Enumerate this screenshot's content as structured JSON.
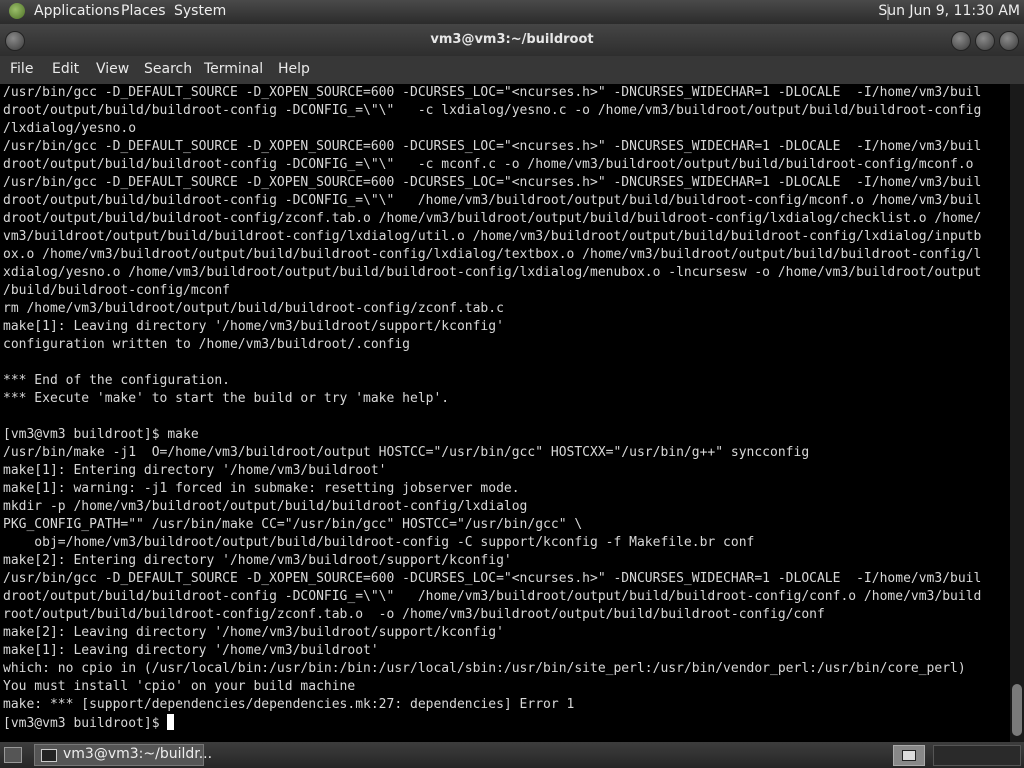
{
  "top_panel": {
    "menus": [
      "Applications",
      "Places",
      "System"
    ],
    "clock": "Sun Jun  9, 11:30 AM"
  },
  "window": {
    "title": "vm3@vm3:~/buildroot"
  },
  "menubar": [
    "File",
    "Edit",
    "View",
    "Search",
    "Terminal",
    "Help"
  ],
  "terminal": {
    "lines": [
      "/usr/bin/gcc -D_DEFAULT_SOURCE -D_XOPEN_SOURCE=600 -DCURSES_LOC=\"<ncurses.h>\" -DNCURSES_WIDECHAR=1 -DLOCALE  -I/home/vm3/buil",
      "droot/output/build/buildroot-config -DCONFIG_=\\\"\\\"   -c lxdialog/yesno.c -o /home/vm3/buildroot/output/build/buildroot-config",
      "/lxdialog/yesno.o",
      "/usr/bin/gcc -D_DEFAULT_SOURCE -D_XOPEN_SOURCE=600 -DCURSES_LOC=\"<ncurses.h>\" -DNCURSES_WIDECHAR=1 -DLOCALE  -I/home/vm3/buil",
      "droot/output/build/buildroot-config -DCONFIG_=\\\"\\\"   -c mconf.c -o /home/vm3/buildroot/output/build/buildroot-config/mconf.o",
      "/usr/bin/gcc -D_DEFAULT_SOURCE -D_XOPEN_SOURCE=600 -DCURSES_LOC=\"<ncurses.h>\" -DNCURSES_WIDECHAR=1 -DLOCALE  -I/home/vm3/buil",
      "droot/output/build/buildroot-config -DCONFIG_=\\\"\\\"   /home/vm3/buildroot/output/build/buildroot-config/mconf.o /home/vm3/buil",
      "droot/output/build/buildroot-config/zconf.tab.o /home/vm3/buildroot/output/build/buildroot-config/lxdialog/checklist.o /home/",
      "vm3/buildroot/output/build/buildroot-config/lxdialog/util.o /home/vm3/buildroot/output/build/buildroot-config/lxdialog/inputb",
      "ox.o /home/vm3/buildroot/output/build/buildroot-config/lxdialog/textbox.o /home/vm3/buildroot/output/build/buildroot-config/l",
      "xdialog/yesno.o /home/vm3/buildroot/output/build/buildroot-config/lxdialog/menubox.o -lncursesw -o /home/vm3/buildroot/output",
      "/build/buildroot-config/mconf",
      "rm /home/vm3/buildroot/output/build/buildroot-config/zconf.tab.c",
      "make[1]: Leaving directory '/home/vm3/buildroot/support/kconfig'",
      "configuration written to /home/vm3/buildroot/.config",
      "",
      "*** End of the configuration.",
      "*** Execute 'make' to start the build or try 'make help'.",
      "",
      "[vm3@vm3 buildroot]$ make",
      "/usr/bin/make -j1  O=/home/vm3/buildroot/output HOSTCC=\"/usr/bin/gcc\" HOSTCXX=\"/usr/bin/g++\" syncconfig",
      "make[1]: Entering directory '/home/vm3/buildroot'",
      "make[1]: warning: -j1 forced in submake: resetting jobserver mode.",
      "mkdir -p /home/vm3/buildroot/output/build/buildroot-config/lxdialog",
      "PKG_CONFIG_PATH=\"\" /usr/bin/make CC=\"/usr/bin/gcc\" HOSTCC=\"/usr/bin/gcc\" \\",
      "    obj=/home/vm3/buildroot/output/build/buildroot-config -C support/kconfig -f Makefile.br conf",
      "make[2]: Entering directory '/home/vm3/buildroot/support/kconfig'",
      "/usr/bin/gcc -D_DEFAULT_SOURCE -D_XOPEN_SOURCE=600 -DCURSES_LOC=\"<ncurses.h>\" -DNCURSES_WIDECHAR=1 -DLOCALE  -I/home/vm3/buil",
      "droot/output/build/buildroot-config -DCONFIG_=\\\"\\\"   /home/vm3/buildroot/output/build/buildroot-config/conf.o /home/vm3/build",
      "root/output/build/buildroot-config/zconf.tab.o  -o /home/vm3/buildroot/output/build/buildroot-config/conf",
      "make[2]: Leaving directory '/home/vm3/buildroot/support/kconfig'",
      "make[1]: Leaving directory '/home/vm3/buildroot'",
      "which: no cpio in (/usr/local/bin:/usr/bin:/bin:/usr/local/sbin:/usr/bin/site_perl:/usr/bin/vendor_perl:/usr/bin/core_perl)",
      "You must install 'cpio' on your build machine",
      "make: *** [support/dependencies/dependencies.mk:27: dependencies] Error 1"
    ],
    "prompt": "[vm3@vm3 buildroot]$ "
  },
  "taskbar": {
    "window_label": "vm3@vm3:~/buildr..."
  },
  "icons": {
    "panel_logo": "gnome-foot-icon",
    "show_desktop": "show-desktop-icon",
    "task_terminal": "terminal-icon"
  }
}
